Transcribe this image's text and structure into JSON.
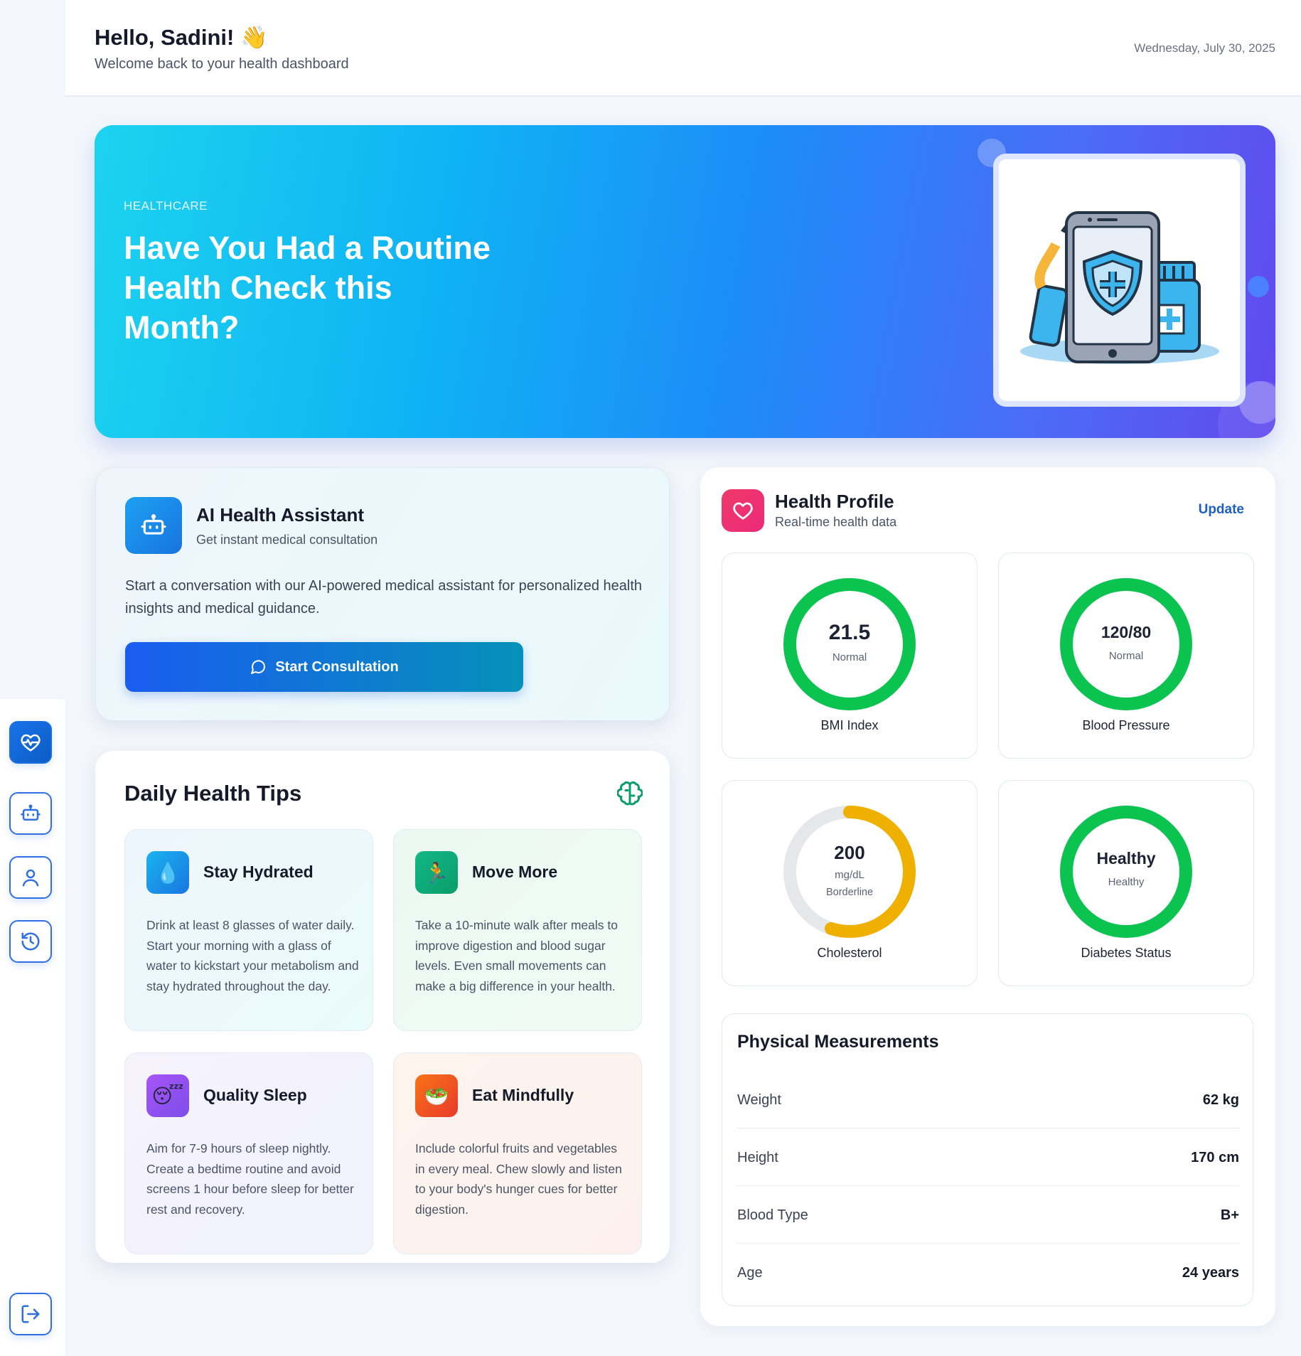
{
  "header": {
    "greeting": "Hello, Sadini! 👋",
    "welcome": "Welcome back to your health dashboard",
    "date": "Wednesday, July 30, 2025"
  },
  "hero": {
    "tag": "HEALTHCARE",
    "title": "Have You Had a Routine Health Check this Month?"
  },
  "sidebar": {
    "items": [
      {
        "icon": "heart-pulse-icon",
        "active": true
      },
      {
        "icon": "robot-icon"
      },
      {
        "icon": "user-icon"
      },
      {
        "icon": "history-icon"
      },
      {
        "icon": "logout-icon"
      }
    ]
  },
  "ai_assistant": {
    "title": "AI Health Assistant",
    "subtitle": "Get instant medical consultation",
    "description": "Start a conversation with our AI-powered medical assistant for personalized health insights and medical guidance.",
    "button_label": "Start Consultation"
  },
  "tips": {
    "title": "Daily Health Tips",
    "items": [
      {
        "title": "Stay Hydrated",
        "icon": "💧",
        "text": "Drink at least 8 glasses of water daily. Start your morning with a glass of water to kickstart your metabolism and stay hydrated throughout the day."
      },
      {
        "title": "Move More",
        "icon": "🏃",
        "text": "Take a 10-minute walk after meals to improve digestion and blood sugar levels. Even small movements can make a big difference in your health."
      },
      {
        "title": "Quality Sleep",
        "icon": "😴",
        "text": "Aim for 7-9 hours of sleep nightly. Create a bedtime routine and avoid screens 1 hour before sleep for better rest and recovery."
      },
      {
        "title": "Eat Mindfully",
        "icon": "🥗",
        "text": "Include colorful fruits and vegetables in every meal. Chew slowly and listen to your body's hunger cues for better digestion."
      }
    ]
  },
  "profile": {
    "title": "Health Profile",
    "subtitle": "Real-time health data",
    "update_label": "Update",
    "metrics": [
      {
        "value": "21.5",
        "unit": "",
        "status": "Normal",
        "label": "BMI Index",
        "fill": 1.0,
        "color": "#0bc450"
      },
      {
        "value": "120/80",
        "unit": "",
        "status": "Normal",
        "label": "Blood Pressure",
        "fill": 1.0,
        "color": "#0bc450"
      },
      {
        "value": "200",
        "unit": "mg/dL",
        "status": "Borderline",
        "label": "Cholesterol",
        "fill": 0.55,
        "color": "#f0b000"
      },
      {
        "value": "Healthy",
        "unit": "",
        "status": "Healthy",
        "label": "Diabetes Status",
        "fill": 1.0,
        "color": "#0bc450"
      }
    ],
    "measurements": {
      "title": "Physical Measurements",
      "rows": [
        {
          "key": "Weight",
          "value": "62 kg"
        },
        {
          "key": "Height",
          "value": "170 cm"
        },
        {
          "key": "Blood Type",
          "value": "B+"
        },
        {
          "key": "Age",
          "value": "24 years"
        }
      ]
    }
  },
  "colors": {
    "accent": "#1a5cf0",
    "heart": "#f0396a",
    "good": "#0bc450",
    "warning": "#f0b000"
  }
}
